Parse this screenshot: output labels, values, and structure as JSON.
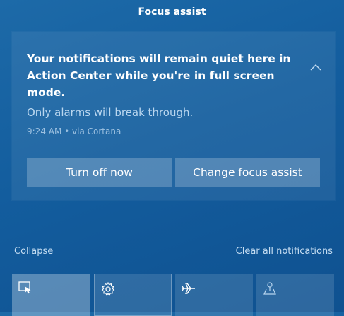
{
  "header": {
    "title": "Focus assist"
  },
  "notification": {
    "message": "Your notifications will remain quiet here in Action Center while you're in full screen mode.",
    "subtext": "Only alarms will break through.",
    "meta": "9:24 AM • via Cortana",
    "collapse_icon": "chevron-up-icon",
    "buttons": {
      "turn_off": "Turn off now",
      "change": "Change focus assist"
    }
  },
  "actions": {
    "collapse": "Collapse",
    "clear_all": "Clear all notifications"
  },
  "quick_actions": [
    {
      "name": "tablet-mode",
      "icon": "tablet-mode-icon",
      "active": true
    },
    {
      "name": "settings",
      "icon": "gear-icon",
      "active": false
    },
    {
      "name": "airplane-mode",
      "icon": "airplane-icon",
      "active": false
    },
    {
      "name": "location",
      "icon": "location-icon",
      "active": false
    }
  ]
}
